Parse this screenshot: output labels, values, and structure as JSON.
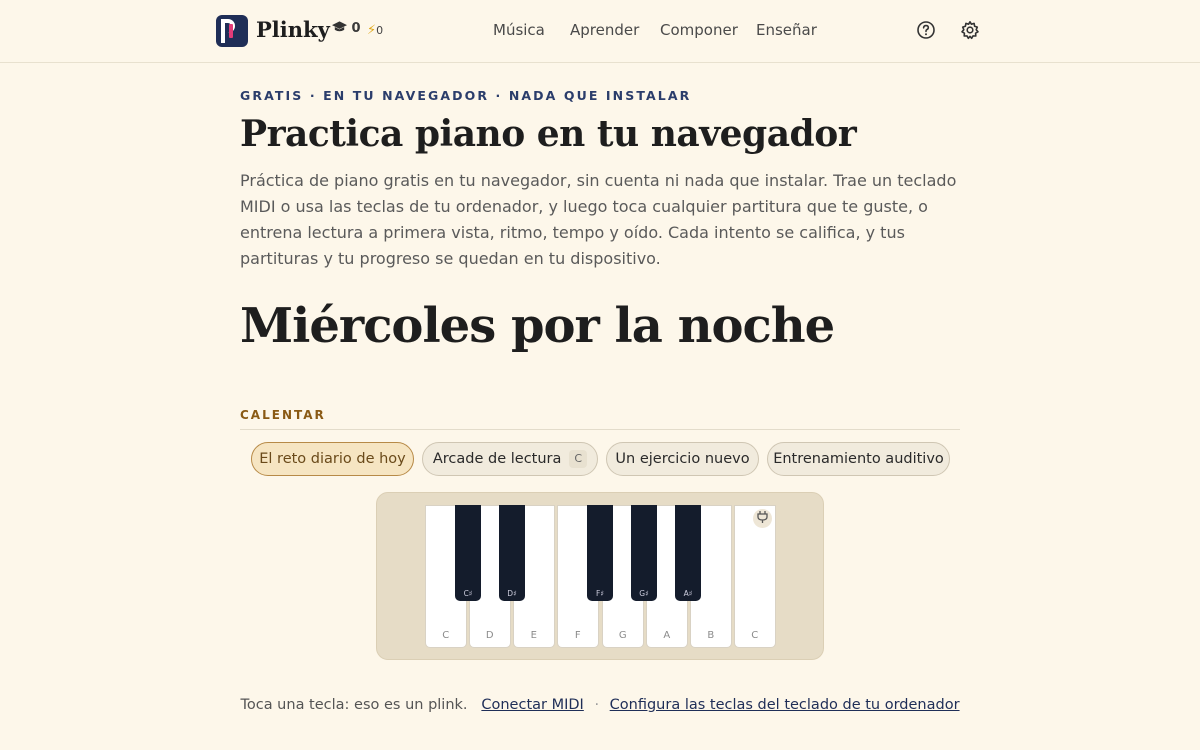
{
  "header": {
    "brand": "Plinky",
    "stats": {
      "lessons_count": "0",
      "streak_count": "0"
    },
    "nav": [
      "Música",
      "Aprender",
      "Componer",
      "Enseñar"
    ],
    "icons": {
      "help": "help-icon",
      "settings": "gear-icon",
      "lessons": "graduation-cap-icon",
      "streak": "lightning-icon"
    }
  },
  "hero": {
    "eyebrow": "GRATIS · EN TU NAVEGADOR · NADA QUE INSTALAR",
    "title": "Practica piano en tu navegador",
    "lede": "Práctica de piano gratis en tu navegador, sin cuenta ni nada que instalar. Trae un teclado MIDI o usa las teclas de tu ordenador, y luego toca cualquier partitura que te guste, o entrena lectura a primera vista, ritmo, tempo y oído. Cada intento se califica, y tus partituras y tu progreso se quedan en tu dispositivo."
  },
  "greeting": "Miércoles por la noche",
  "warmup": {
    "label": "CALENTAR",
    "chips": [
      {
        "label": "El reto diario de hoy",
        "active": true
      },
      {
        "label": "Arcade de lectura",
        "shortcut": "C"
      },
      {
        "label": "Un ejercicio nuevo"
      },
      {
        "label": "Entrenamiento auditivo"
      }
    ]
  },
  "piano": {
    "white_keys": [
      "C",
      "D",
      "E",
      "F",
      "G",
      "A",
      "B",
      "C"
    ],
    "black_keys": [
      "C♯",
      "D♯",
      "F♯",
      "G♯",
      "A♯"
    ],
    "plug_icon": "plug-icon"
  },
  "footer": {
    "text": "Toca una tecla: eso es un plink.",
    "connect_midi": "Conectar MIDI",
    "separator": "·",
    "configure_keys": "Configura las teclas del teclado de tu ordenador"
  },
  "colors": {
    "accent": "#1f2e57",
    "background": "#fdf7ea",
    "section_label": "#8a5a14"
  }
}
